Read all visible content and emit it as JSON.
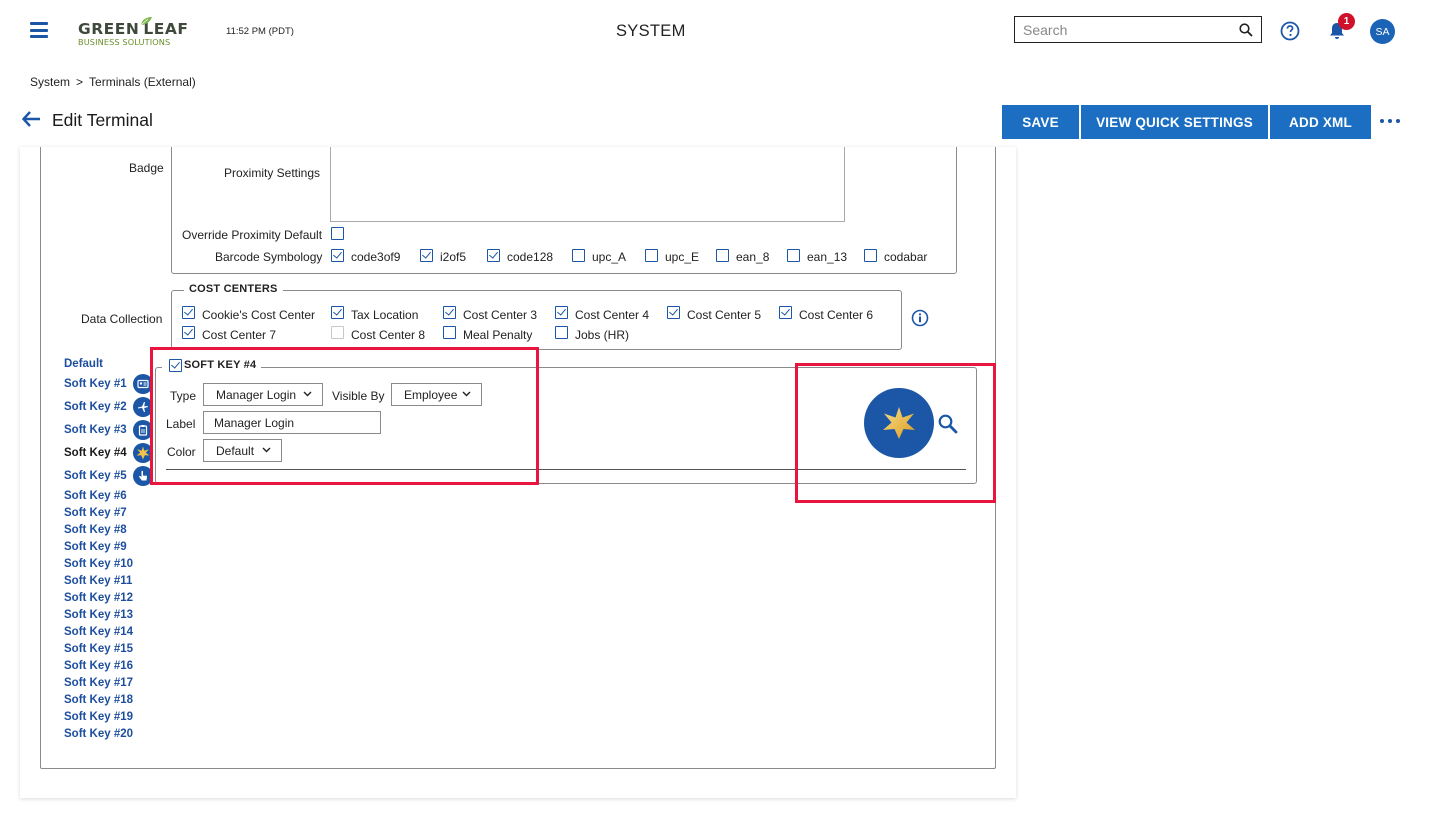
{
  "header": {
    "logo_top": "GREEN",
    "logo_top2": "LEAF",
    "logo_bottom": "BUSINESS SOLUTIONS",
    "clock": "11:52 PM (PDT)",
    "app_title": "SYSTEM",
    "search_placeholder": "Search",
    "notification_count": "1",
    "avatar_initials": "SA"
  },
  "breadcrumb": {
    "root": "System",
    "separator": ">",
    "current": "Terminals (External)"
  },
  "page": {
    "title": "Edit Terminal"
  },
  "actions": {
    "save": "SAVE",
    "view_quick_settings": "VIEW QUICK SETTINGS",
    "add_xml": "ADD XML"
  },
  "badge": {
    "section_label": "Badge",
    "proximity_settings_label": "Proximity Settings",
    "override_label": "Override Proximity Default",
    "barcode_label": "Barcode Symbology",
    "symbologies": [
      {
        "label": "code3of9",
        "checked": true
      },
      {
        "label": "i2of5",
        "checked": true
      },
      {
        "label": "code128",
        "checked": true
      },
      {
        "label": "upc_A",
        "checked": false
      },
      {
        "label": "upc_E",
        "checked": false
      },
      {
        "label": "ean_8",
        "checked": false
      },
      {
        "label": "ean_13",
        "checked": false
      },
      {
        "label": "codabar",
        "checked": false
      }
    ]
  },
  "data_collection": {
    "section_label": "Data Collection",
    "legend": "COST CENTERS",
    "items": [
      {
        "label": "Cookie's Cost Center",
        "checked": true
      },
      {
        "label": "Tax Location",
        "checked": true
      },
      {
        "label": "Cost Center 3",
        "checked": true
      },
      {
        "label": "Cost Center 4",
        "checked": true
      },
      {
        "label": "Cost Center 5",
        "checked": true
      },
      {
        "label": "Cost Center 6",
        "checked": true
      },
      {
        "label": "Cost Center 7",
        "checked": true
      },
      {
        "label": "Cost Center 8",
        "checked": false,
        "disabled": true
      },
      {
        "label": "Meal Penalty",
        "checked": false
      },
      {
        "label": "Jobs (HR)",
        "checked": false
      }
    ]
  },
  "soft_keys": {
    "default_label": "Default",
    "items": [
      "Soft Key #1",
      "Soft Key #2",
      "Soft Key #3",
      "Soft Key #4",
      "Soft Key #5",
      "Soft Key #6",
      "Soft Key #7",
      "Soft Key #8",
      "Soft Key #9",
      "Soft Key #10",
      "Soft Key #11",
      "Soft Key #12",
      "Soft Key #13",
      "Soft Key #14",
      "Soft Key #15",
      "Soft Key #16",
      "Soft Key #17",
      "Soft Key #18",
      "Soft Key #19",
      "Soft Key #20"
    ],
    "active_index": 3
  },
  "soft_key_editor": {
    "legend": "SOFT KEY #4",
    "enabled": true,
    "type_label": "Type",
    "type_value": "Manager Login",
    "visible_by_label": "Visible By",
    "visible_by_value": "Employee",
    "label_label": "Label",
    "label_value": "Manager Login",
    "color_label": "Color",
    "color_value": "Default"
  },
  "colors": {
    "primary": "#1b6ec2",
    "link": "#1d4e9e",
    "highlight": "#e8163f",
    "badge": "#d0112b"
  }
}
